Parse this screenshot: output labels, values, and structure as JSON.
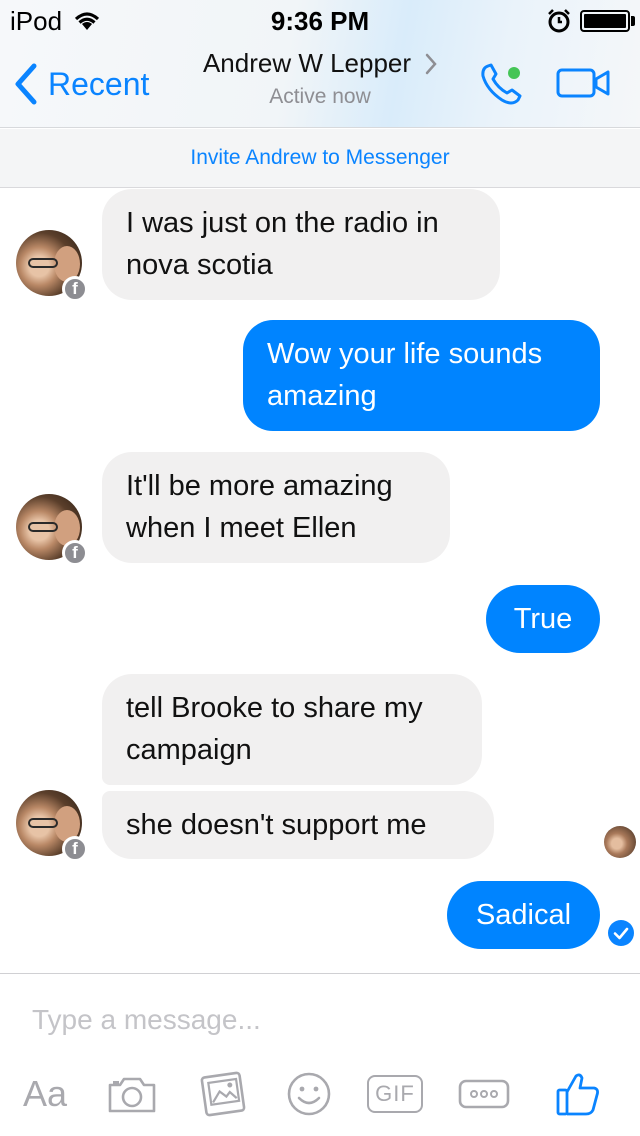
{
  "status_bar": {
    "carrier": "iPod",
    "time": "9:36 PM",
    "battery_level": 1.0
  },
  "header": {
    "back_label": "Recent",
    "contact_name": "Andrew W Lepper",
    "contact_status": "Active now",
    "active_dot_color": "#44c556",
    "accent_color": "#0a84ff"
  },
  "invite_banner": {
    "text": "Invite Andrew to Messenger"
  },
  "messages": [
    {
      "sender": "them",
      "text_lines": [
        "I was just on the radio in",
        "nova scotia"
      ]
    },
    {
      "sender": "me",
      "text_lines": [
        "Wow your life sounds",
        "amazing"
      ]
    },
    {
      "sender": "them",
      "text_lines": [
        "It'll be more amazing",
        "when I meet Ellen"
      ]
    },
    {
      "sender": "me",
      "text_lines": [
        "True"
      ]
    },
    {
      "sender": "them",
      "text_lines": [
        "tell Brooke to share my",
        "campaign"
      ]
    },
    {
      "sender": "them",
      "text_lines": [
        "she doesn't support me"
      ]
    },
    {
      "sender": "me",
      "text_lines": [
        "Sadical"
      ]
    }
  ],
  "colors": {
    "outgoing_bubble": "#0084ff",
    "incoming_bubble": "#f1f0f0"
  },
  "composer": {
    "placeholder": "Type a message...",
    "text_tool_label": "Aa",
    "gif_label": "GIF",
    "tools": [
      "text-format-icon",
      "camera-icon",
      "gallery-icon",
      "emoji-icon",
      "gif-icon",
      "more-icon",
      "thumbs-up-icon"
    ]
  }
}
